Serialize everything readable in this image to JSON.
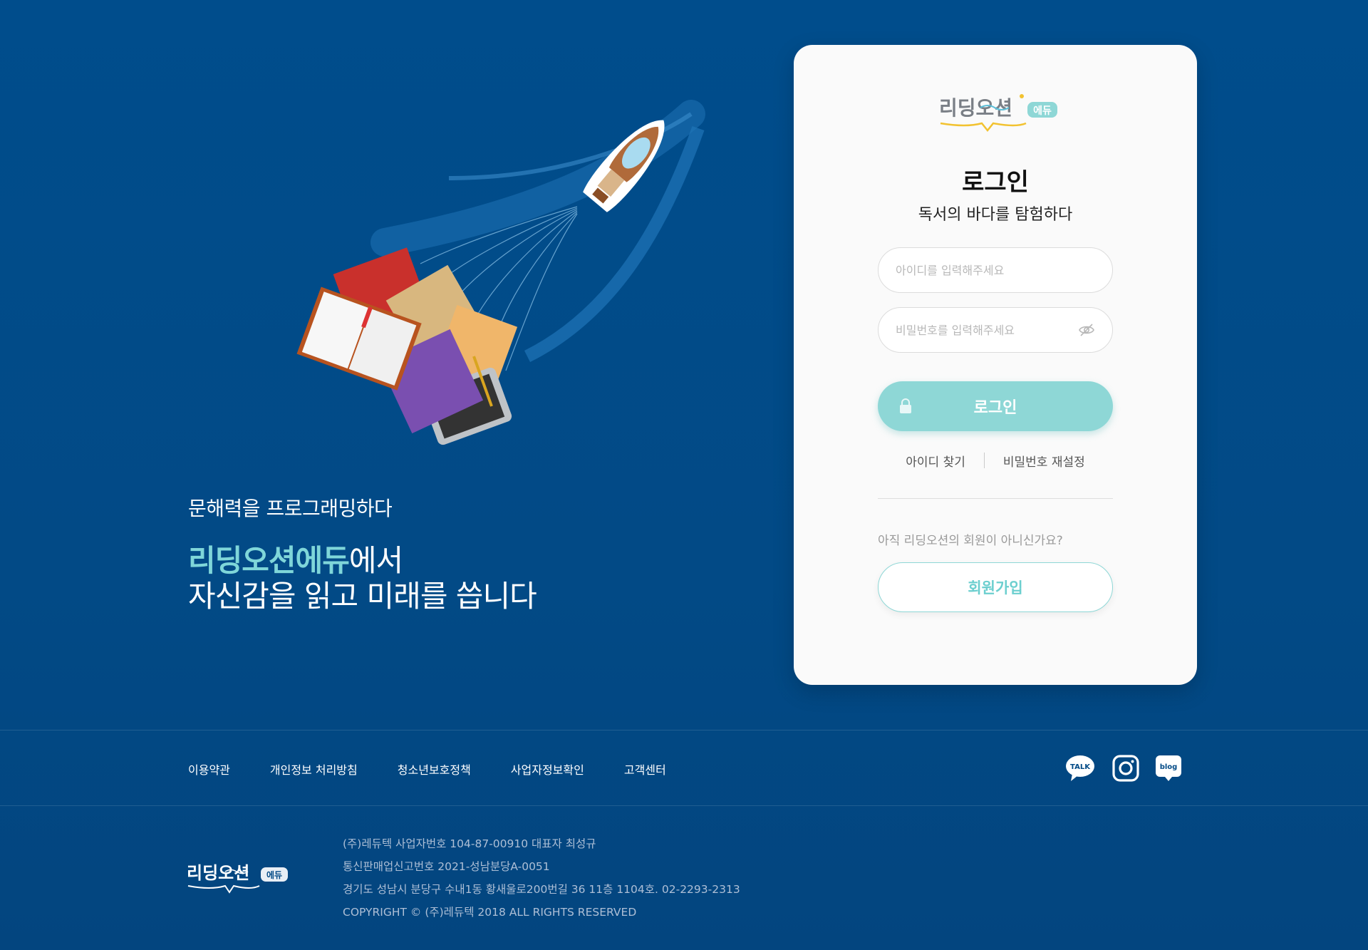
{
  "hero": {
    "subtitle": "문해력을 프로그래밍하다",
    "brand": "리딩오션에듀",
    "line1_suffix": "에서",
    "line2": "자신감을 읽고 미래를 씁니다"
  },
  "logo": {
    "text": "리딩오션",
    "badge": "에듀"
  },
  "login": {
    "title": "로그인",
    "subtitle": "독서의 바다를 탐험하다",
    "id_placeholder": "아이디를 입력해주세요",
    "id_value": "",
    "pw_placeholder": "비밀번호를 입력해주세요",
    "pw_value": "",
    "submit_label": "로그인",
    "find_id": "아이디 찾기",
    "reset_pw": "비밀번호 재설정",
    "signup_prompt": "아직 리딩오션의 회원이 아니신가요?",
    "signup_label": "회원가입"
  },
  "footer": {
    "links": [
      "이용약관",
      "개인정보 처리방침",
      "청소년보호정책",
      "사업자정보확인",
      "고객센터"
    ],
    "social": {
      "talk": "TALK",
      "blog": "blog"
    },
    "info": [
      "(주)레듀텍 사업자번호 104-87-00910 대표자 최성규",
      "통신판매업신고번호 2021-성남분당A-0051",
      "경기도 성남시 분당구 수내1동 황새울로200번길 36 11층 1104호. 02-2293-2313",
      "COPYRIGHT © (주)레듀텍 2018 ALL RIGHTS RESERVED"
    ]
  },
  "colors": {
    "background": "#004d8c",
    "accent": "#8ed7d6",
    "brand_text": "#7fd6d9",
    "card": "#fafafa"
  },
  "icons": [
    "boat-illustration",
    "books-illustration",
    "eye-off-icon",
    "lock-icon",
    "kakaotalk-icon",
    "instagram-icon",
    "blog-icon"
  ]
}
